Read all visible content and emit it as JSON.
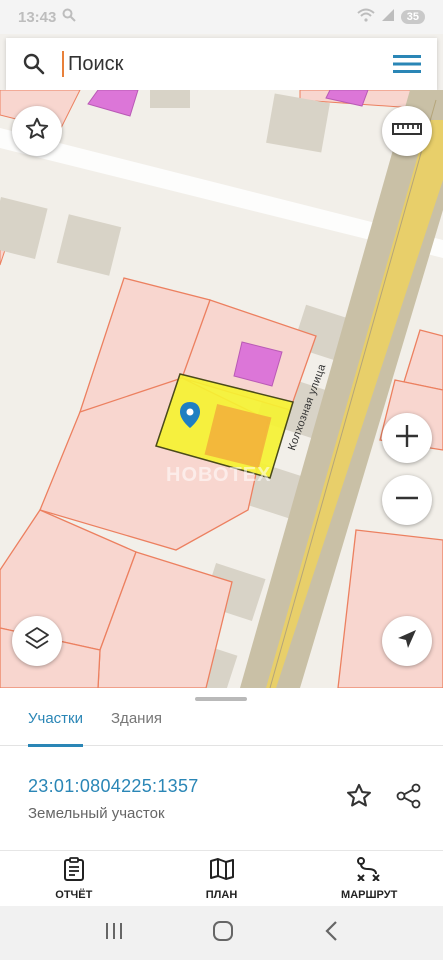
{
  "status_bar": {
    "time": "13:43",
    "battery": "35"
  },
  "search": {
    "placeholder": "Поиск"
  },
  "map": {
    "street_label": "Колхозная улица",
    "watermark": "НОВОТЕХ",
    "buttons": [
      "star-icon",
      "ruler-icon",
      "zoom-in-icon",
      "zoom-out-icon",
      "layers-icon",
      "locate-icon"
    ]
  },
  "sheet": {
    "tabs": [
      {
        "label": "Участки",
        "active": true
      },
      {
        "label": "Здания",
        "active": false
      }
    ],
    "parcel": {
      "cadastral_number": "23:01:0804225:1357",
      "type": "Земельный участок"
    }
  },
  "bottom_nav": [
    {
      "label": "ОТЧЁТ"
    },
    {
      "label": "ПЛАН"
    },
    {
      "label": "МАРШРУТ"
    }
  ],
  "colors": {
    "accent": "#2a86b6",
    "parcel_fill": "#f8d6cf",
    "parcel_border": "#ec8060",
    "selected": "#f5f232",
    "building_magenta": "#dc76d8"
  }
}
